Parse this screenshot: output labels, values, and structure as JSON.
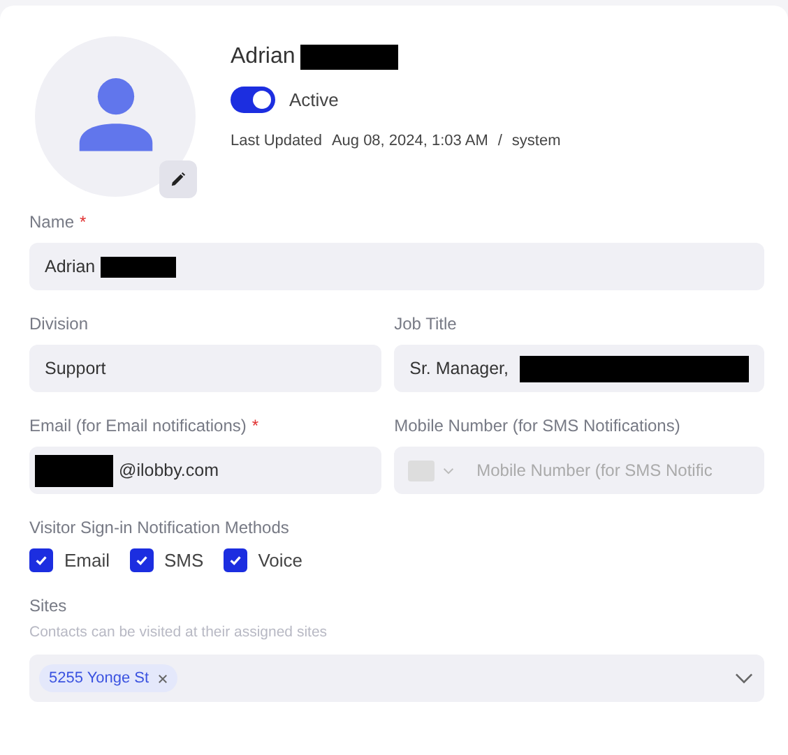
{
  "profile": {
    "name": "Adrian",
    "redacted_after": true,
    "active": true,
    "status_label": "Active",
    "updated_label": "Last Updated",
    "updated_at": "Aug 08, 2024, 1:03 AM",
    "separator": "/",
    "updated_by": "system"
  },
  "fields": [
    {
      "label": "Name",
      "required_mark": "*",
      "value": "Adrian",
      "redacted_after": true
    },
    {
      "label": "Division",
      "value": "Support"
    },
    {
      "label": "Job Title",
      "value": "Sr. Manager,",
      "redacted_after": true
    },
    {
      "label": "Email (for Email notifications)",
      "required_mark": "*",
      "value": "@ilobby.com",
      "redacted_before": true
    },
    {
      "label": "Mobile Number (for SMS Notifications)",
      "placeholder": "Mobile Number (for SMS Notific",
      "kind": "phone"
    }
  ],
  "notifications": {
    "label": "Visitor Sign-in Notification Methods",
    "options": [
      {
        "label": "Email",
        "checked": true
      },
      {
        "label": "SMS",
        "checked": true
      },
      {
        "label": "Voice",
        "checked": true
      }
    ]
  },
  "sites": {
    "label": "Sites",
    "hint": "Contacts can be visited at their assigned sites",
    "tags": [
      "5255 Yonge St"
    ]
  }
}
